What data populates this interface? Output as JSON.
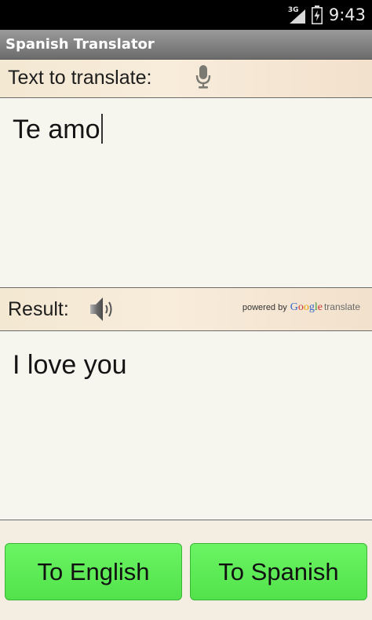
{
  "status_bar": {
    "network_label": "3G",
    "time": "9:43",
    "icons": [
      "signal-icon",
      "battery-charging-icon"
    ]
  },
  "app": {
    "title": "Spanish Translator"
  },
  "input_section": {
    "label": "Text to translate:",
    "mic_icon": "microphone-icon",
    "text_value": "Te amo"
  },
  "result_section": {
    "label": "Result:",
    "speaker_icon": "speaker-icon",
    "attribution": {
      "powered_by": "powered by",
      "brand_letters": [
        "G",
        "o",
        "o",
        "g",
        "l",
        "e"
      ],
      "brand_colors": [
        "#3366cc",
        "#cc3333",
        "#e8a000",
        "#3366cc",
        "#339933",
        "#cc3333"
      ],
      "translate_word": "translate"
    },
    "text_value": "I love you"
  },
  "actions": {
    "to_english_label": "To English",
    "to_spanish_label": "To Spanish"
  },
  "colors": {
    "button_green": "#5ceb55",
    "label_band": "#f6ead7",
    "panel_bg": "#f7f6ee",
    "title_bar": "#808080"
  }
}
